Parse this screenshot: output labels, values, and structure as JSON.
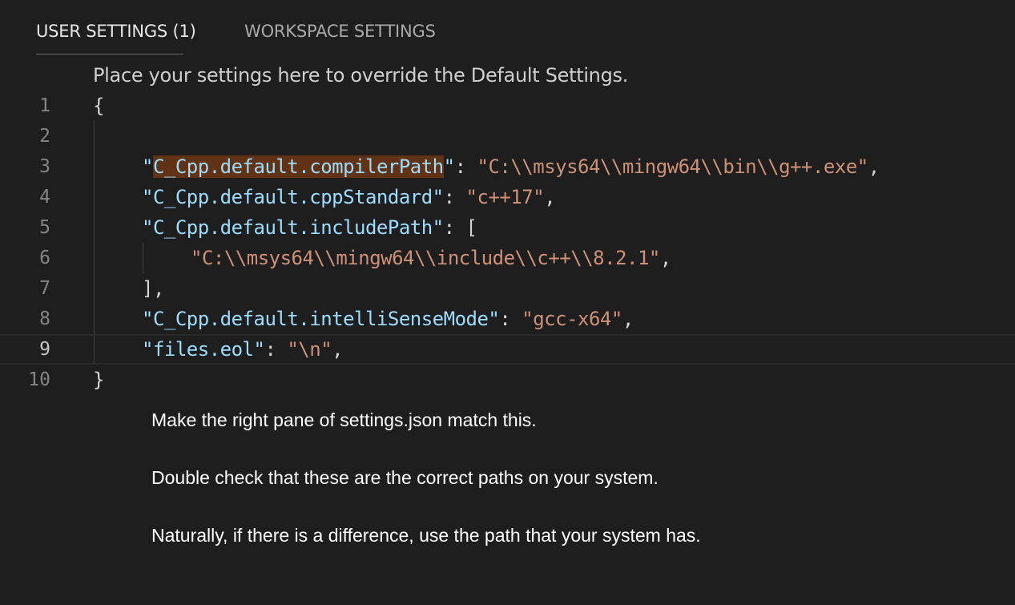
{
  "tabs": [
    {
      "label": "USER SETTINGS (1)",
      "active": true
    },
    {
      "label": "WORKSPACE SETTINGS",
      "active": false
    }
  ],
  "editor": {
    "placeholder": "Place your settings here to override the Default Settings.",
    "current_line": 9,
    "lines": [
      {
        "number": "1",
        "open": "{"
      },
      {
        "number": "2"
      },
      {
        "number": "3",
        "key_q1": "\"",
        "key_hl": "C_Cpp.default.compilerPath",
        "key_q2": "\"",
        "sep": ": ",
        "value": "\"C:\\\\msys64\\\\mingw64\\\\bin\\\\g++.exe\"",
        "end": ","
      },
      {
        "number": "4",
        "key": "\"C_Cpp.default.cppStandard\"",
        "sep": ": ",
        "value": "\"c++17\"",
        "end": ","
      },
      {
        "number": "5",
        "key": "\"C_Cpp.default.includePath\"",
        "sep": ": ",
        "bracket": "["
      },
      {
        "number": "6",
        "value": "\"C:\\\\msys64\\\\mingw64\\\\include\\\\c++\\\\8.2.1\"",
        "end": ","
      },
      {
        "number": "7",
        "close": "],"
      },
      {
        "number": "8",
        "key": "\"C_Cpp.default.intelliSenseMode\"",
        "sep": ": ",
        "value": "\"gcc-x64\"",
        "end": ","
      },
      {
        "number": "9",
        "key": "\"files.eol\"",
        "sep": ": ",
        "value": "\"\\n\"",
        "end": ","
      },
      {
        "number": "10",
        "close": "}"
      }
    ]
  },
  "notes": [
    "Make the right pane of settings.json match this.",
    "Double check that these are the correct paths on your system.",
    "Naturally, if there is a difference, use the path that your system has."
  ],
  "colors": {
    "background": "#1e1e1e",
    "key": "#9cdcfe",
    "string": "#ce9178",
    "highlight": "#613214"
  }
}
